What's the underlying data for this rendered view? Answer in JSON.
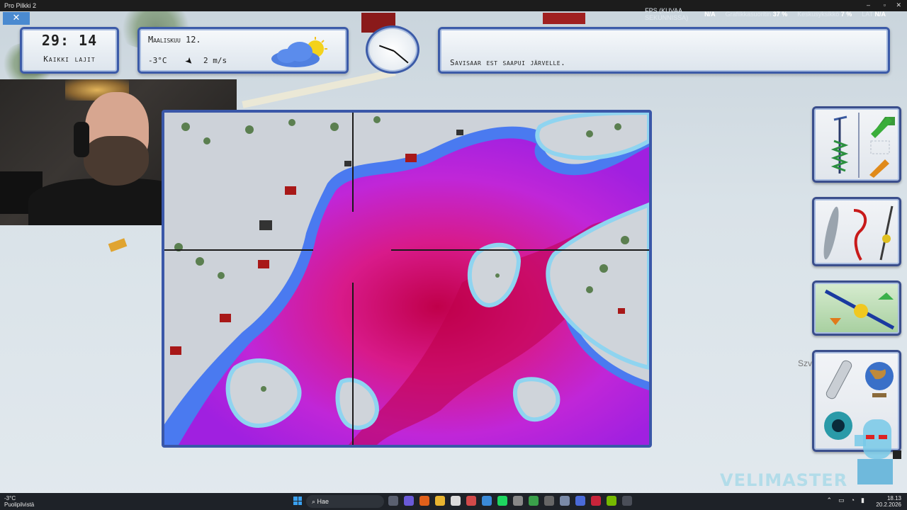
{
  "window": {
    "title": "Pro Pilkki 2",
    "minimize": "–",
    "maximize": "▫",
    "close": "✕"
  },
  "overlay_close": "✕",
  "perf": {
    "fps_label": "FPS (KUVAA SEKUNNISSA)",
    "fps_value": "N/A",
    "gpu_label": "Grafiikkasuoritin",
    "gpu_value": "37 %",
    "cpu_label": "Keskusyksikkö",
    "cpu_value": "7 %",
    "lat_label": "LAT",
    "lat_value": "N/A"
  },
  "hud": {
    "time": "29: 14",
    "mode": "Kaikki lajit",
    "date": "Maaliskuu 12.",
    "temperature": "-3°C",
    "wind": "2 m/s",
    "wind_arrow": "➤",
    "weather_icon": "partly-cloudy-icon",
    "message": "Savisaar est saapui järvelle."
  },
  "side_label": "Szv",
  "watermark": "VELIMASTER",
  "taskbar": {
    "weather_temp": "-3°C",
    "weather_text": "Puolipilvistä",
    "search": "Hae",
    "time": "18.13",
    "date": "20.2.2026"
  },
  "colors": {
    "panel_border": "#3c5ba8",
    "deep_water": "#c0004a",
    "mid_water": "#d020c8",
    "shallow_water": "#4a7af0",
    "shore": "#8fd4f0"
  }
}
